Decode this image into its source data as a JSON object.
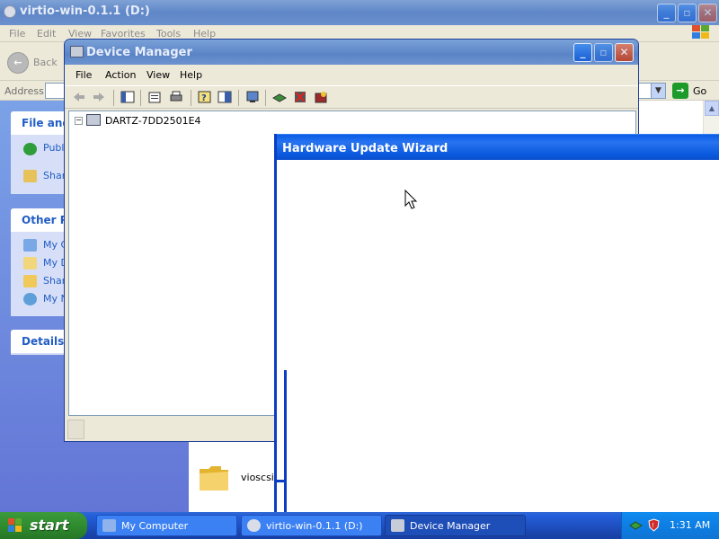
{
  "explorer": {
    "title": "virtio-win-0.1.1 (D:)",
    "menu": [
      "File",
      "Edit",
      "View",
      "Favorites",
      "Tools",
      "Help"
    ],
    "back_label": "Back",
    "address_label": "Address",
    "go_label": "Go",
    "sidebar": {
      "file_tasks": {
        "title": "File and",
        "items": [
          "Publi Web",
          "Shar"
        ]
      },
      "other_places": {
        "title": "Other Pl",
        "items": [
          "My C",
          "My D",
          "Shar",
          "My N"
        ]
      },
      "details": {
        "title": "Details"
      }
    },
    "folder_label": "vioscsi"
  },
  "device_manager": {
    "title": "Device Manager",
    "menu": [
      "File",
      "Action",
      "View",
      "Help"
    ],
    "tree_root": "DARTZ-7DD2501E4",
    "toggle": "−"
  },
  "wizard": {
    "title": "Hardware Update Wizard"
  },
  "taskbar": {
    "start_label": "start",
    "buttons": [
      {
        "label": "My Computer",
        "icon": "computer-icon",
        "active": false
      },
      {
        "label": "virtio-win-0.1.1 (D:)",
        "icon": "cd-drive-icon",
        "active": false
      },
      {
        "label": "Device Manager",
        "icon": "device-manager-icon",
        "active": true
      }
    ],
    "clock": "1:31 AM"
  },
  "colors": {
    "xp_blue": "#245edb",
    "start_green": "#2f8c2f",
    "task_link": "#215dc6"
  }
}
